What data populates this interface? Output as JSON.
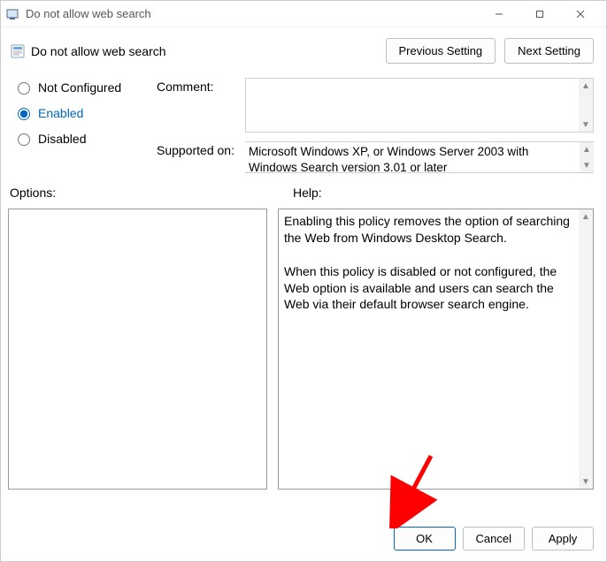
{
  "titlebar": {
    "title": "Do not allow web search"
  },
  "subheader": {
    "title": "Do not allow web search",
    "prev": "Previous Setting",
    "next": "Next Setting"
  },
  "radios": {
    "not_configured": "Not Configured",
    "enabled": "Enabled",
    "disabled": "Disabled",
    "selected": "enabled"
  },
  "fields": {
    "comment_label": "Comment:",
    "comment_value": "",
    "supported_label": "Supported on:",
    "supported_value": "Microsoft Windows XP, or Windows Server 2003 with Windows Search version 3.01 or later"
  },
  "sections": {
    "options_label": "Options:",
    "help_label": "Help:"
  },
  "help_text": "Enabling this policy removes the option of searching the Web from Windows Desktop Search.\n\nWhen this policy is disabled or not configured, the Web option is available and users can search the Web via their default browser search engine.",
  "footer": {
    "ok": "OK",
    "cancel": "Cancel",
    "apply": "Apply"
  }
}
